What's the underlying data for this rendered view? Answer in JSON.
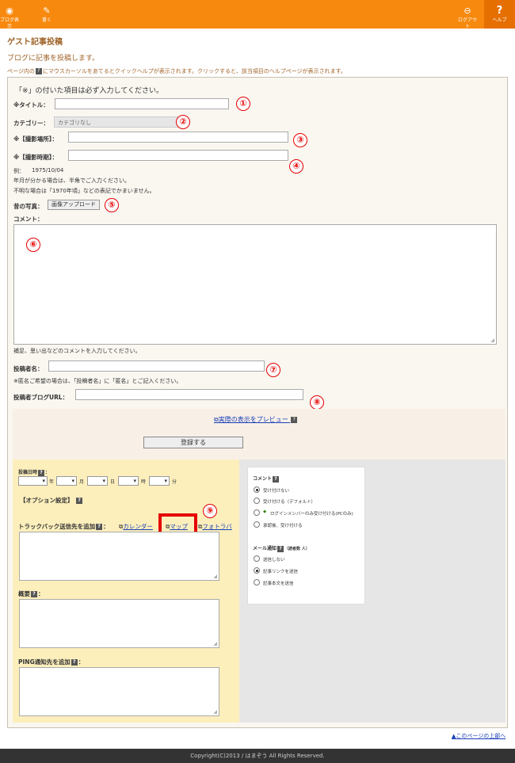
{
  "header": {
    "blog_view": "ブログ表示",
    "write": "書く",
    "logout": "ログアウト",
    "help": "ヘルプ",
    "help_glyph": "?",
    "accent": "#f7890e"
  },
  "page": {
    "title": "ゲスト記事投稿",
    "subtitle": "ブログに記事を投稿します。",
    "hint_before": "ページ内の",
    "hint_after": "にマウスカーソルをあてるとクイックヘルプが表示されます。クリックすると、該当項目のヘルプページが表示されます。"
  },
  "form": {
    "required_note": "「※」の付いた項目は必ず入力してください。",
    "title_label": "※タイトル：",
    "category_label": "カテゴリー：",
    "category_value": "カテゴリなし",
    "place_label": "※【撮影場所】：",
    "time_label": "※【撮影時期】：",
    "example_label": "例：",
    "example_value": "1975/10/04",
    "note1": "年月が分かる場合は、半角でご入力ください。",
    "note2": "不明な場合は「1970年頃」などの表記でかまいません。",
    "photo_label": "昔の写真：",
    "upload_button": "画像アップロード",
    "comment_label": "コメント：",
    "comment_note": "補足、思い出などのコメントを入力してください。",
    "author_label": "投稿者名：",
    "author_note": "※匿名ご希望の場合は、「投稿者名」に「匿名」とご記入ください。",
    "blog_url_label": "投稿者ブログURL：",
    "preview_link": "実際の表示をプレビュー",
    "submit_button": "登録する"
  },
  "options": {
    "date_label": "投稿日時",
    "year": "年",
    "month": "月",
    "day": "日",
    "hour": "時",
    "minute": "分",
    "option_title": "【オプション設定】",
    "trackback_label": "トラックバック送信先を追加",
    "calendar_link": "カレンダー",
    "map_link": "マップ",
    "photo_link": "フォトラバ",
    "summary_label": "概要",
    "ping_label": "PING通知先を追加"
  },
  "right": {
    "comment_title": "コメント",
    "comment_options": [
      {
        "label": "受け付けない",
        "checked": true
      },
      {
        "label": "受け付ける（デフォルト）",
        "checked": false
      },
      {
        "label": "ログインメンバーのみ受け付ける(PCのみ)",
        "checked": false
      },
      {
        "label": "承認後、受け付ける",
        "checked": false
      }
    ],
    "mail_title": "メール通知",
    "mail_sub": "（読者数 人）",
    "mail_options": [
      {
        "label": "送信しない",
        "checked": false
      },
      {
        "label": "記事リンクを送信",
        "checked": true
      },
      {
        "label": "記事本文を送信",
        "checked": false
      }
    ]
  },
  "markers": [
    "①",
    "②",
    "③",
    "④",
    "⑤",
    "⑥",
    "⑦",
    "⑧",
    "⑨"
  ],
  "footer": {
    "top_link": "▲このページの上部へ",
    "copyright": "Copyright(C)2013 / はまぞう All Rights Reserved."
  }
}
